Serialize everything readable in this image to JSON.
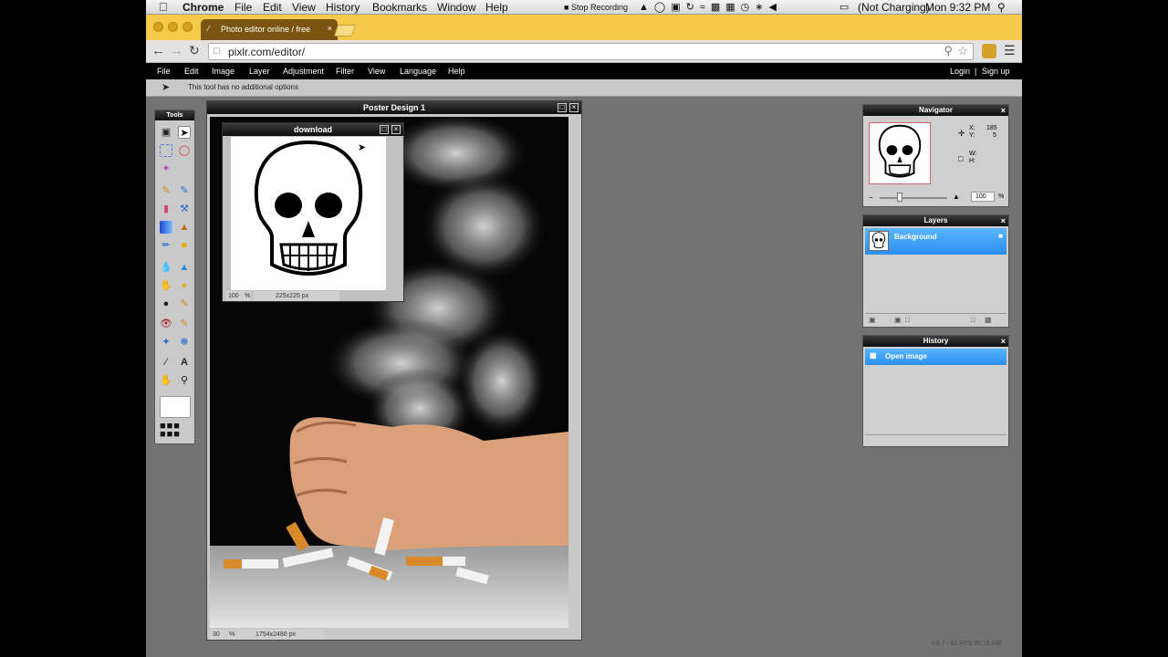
{
  "macbar": {
    "apple": "",
    "app_name": "Chrome",
    "menus": [
      "File",
      "Edit",
      "View",
      "History",
      "Bookmarks",
      "Window",
      "Help"
    ],
    "stop_recording": "Stop Recording",
    "battery": "(Not Charging)",
    "clock": "Mon 9:32 PM"
  },
  "browser": {
    "tab_title": "Photo editor online / free",
    "url": "pixlr.com/editor/"
  },
  "pixlr_menu": {
    "items": [
      "File",
      "Edit",
      "Image",
      "Layer",
      "Adjustment",
      "Filter",
      "View",
      "Language",
      "Help"
    ],
    "login": "Login",
    "separator": "|",
    "signup": "Sign up"
  },
  "options_bar": {
    "text": "This tool has no additional options"
  },
  "tools_panel": {
    "title": "Tools"
  },
  "document": {
    "title": "Poster Design 1",
    "zoom": "30",
    "zoom_unit": "%",
    "size": "1754x2480 px"
  },
  "download_window": {
    "title": "download",
    "zoom": "100",
    "zoom_unit": "%",
    "size": "225x225 px"
  },
  "navigator": {
    "title": "Navigator",
    "x_label": "X:",
    "x_value": "185",
    "y_label": "Y:",
    "y_value": "5",
    "w_label": "W:",
    "h_label": "H:",
    "zoom": "100",
    "zoom_unit": "%"
  },
  "layers": {
    "title": "Layers",
    "layer_name": "Background"
  },
  "history": {
    "title": "History",
    "entry": "Open image"
  },
  "fps_text": "v.6.7 - 61 FPS 20.16 MB",
  "colors": {
    "tab_bar": "#f5c94a",
    "selection_blue": "#2a8ef0",
    "workspace": "#737373"
  }
}
